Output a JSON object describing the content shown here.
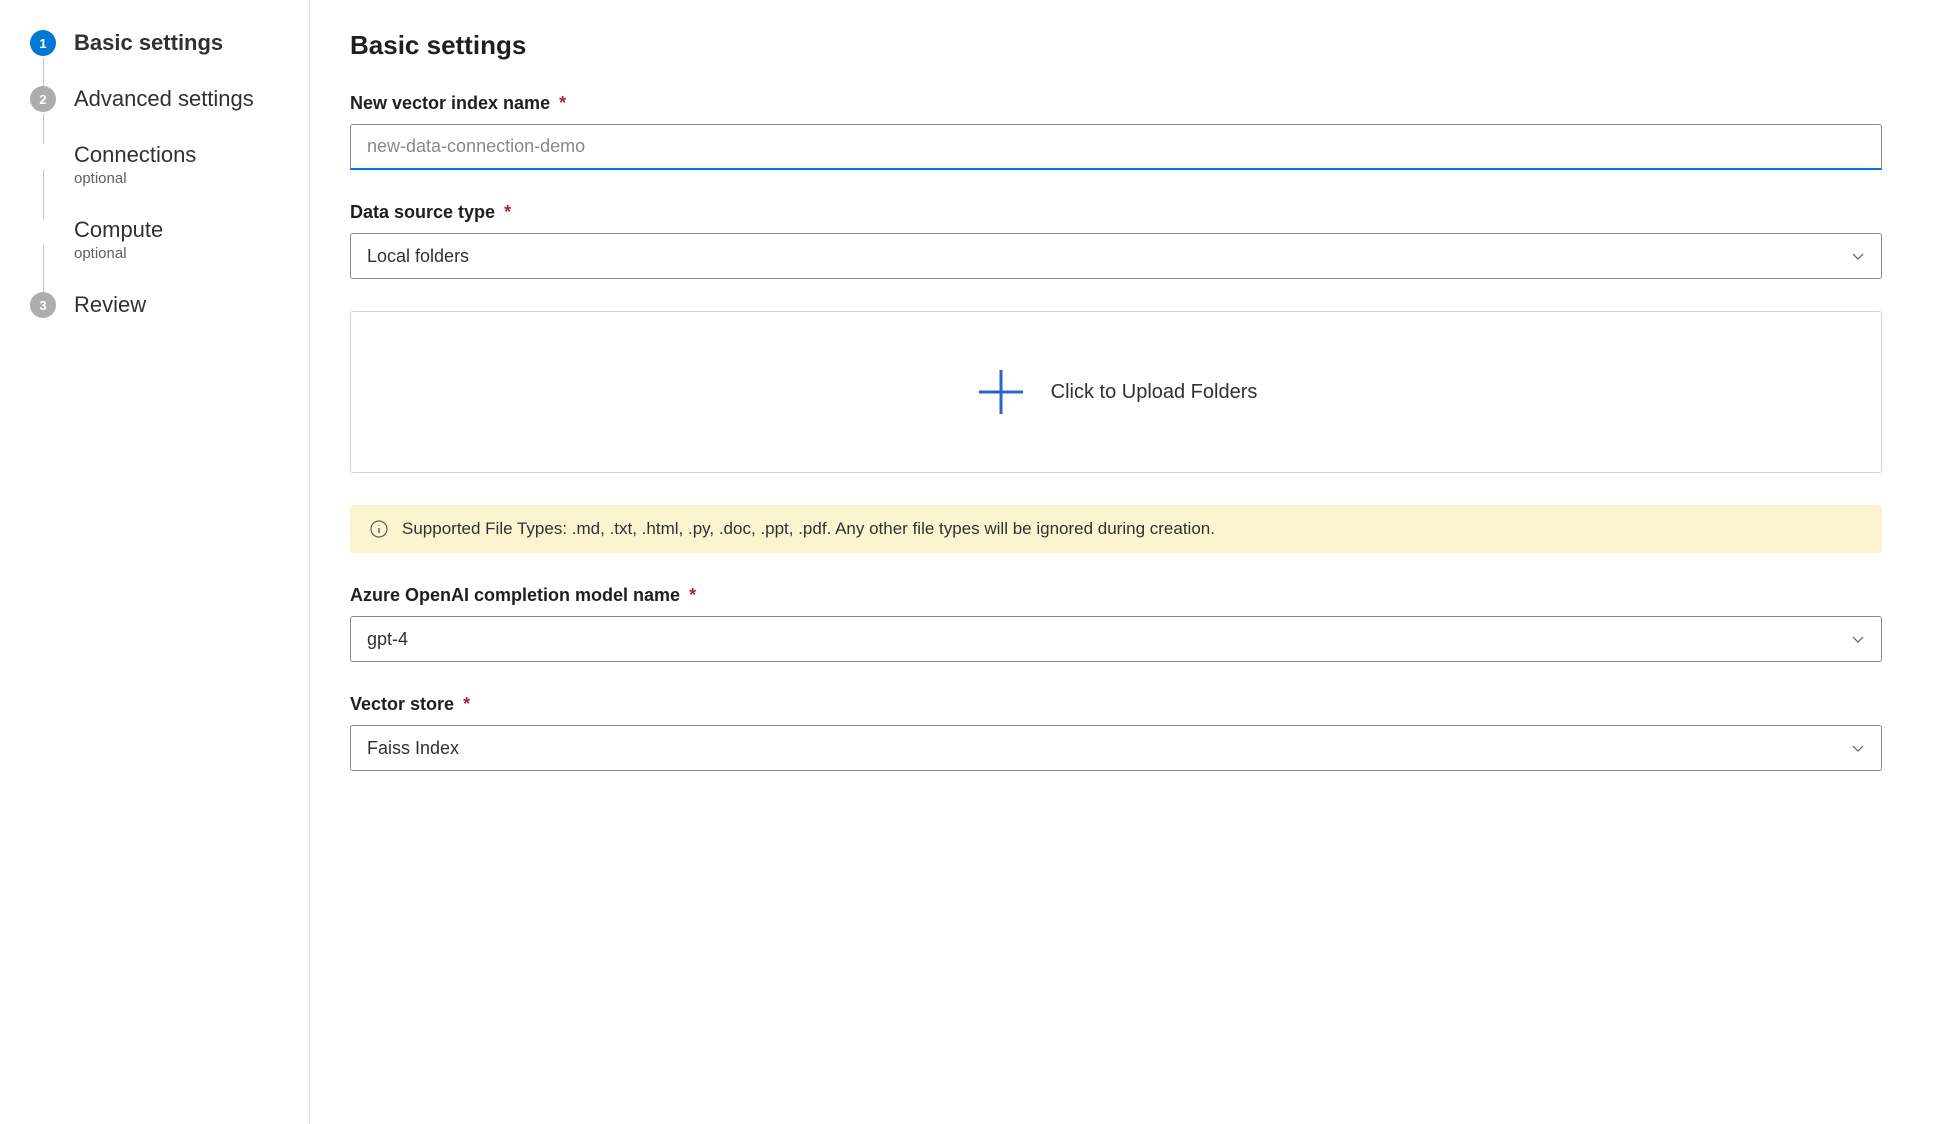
{
  "sidebar": {
    "steps": [
      {
        "number": "1",
        "label": "Basic settings",
        "active": true
      },
      {
        "number": "2",
        "label": "Advanced settings",
        "active": false
      },
      {
        "label": "Connections",
        "sublabel": "optional",
        "substep": true
      },
      {
        "label": "Compute",
        "sublabel": "optional",
        "substep": true
      },
      {
        "number": "3",
        "label": "Review",
        "active": false
      }
    ]
  },
  "main": {
    "title": "Basic settings",
    "fields": {
      "index_name": {
        "label": "New vector index name",
        "placeholder": "new-data-connection-demo",
        "required": "*"
      },
      "data_source": {
        "label": "Data source type",
        "value": "Local folders",
        "required": "*"
      },
      "upload": {
        "text": "Click to Upload Folders"
      },
      "info": {
        "text": "Supported File Types: .md, .txt, .html, .py, .doc, .ppt, .pdf. Any other file types will be ignored during creation."
      },
      "completion_model": {
        "label": "Azure OpenAI completion model name",
        "value": "gpt-4",
        "required": "*"
      },
      "vector_store": {
        "label": "Vector store",
        "value": "Faiss Index",
        "required": "*"
      }
    }
  }
}
